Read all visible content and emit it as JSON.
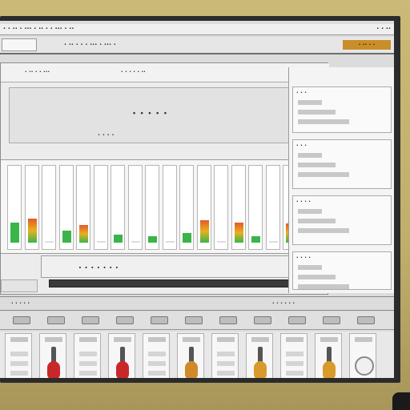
{
  "menubar": {
    "left_text": "· · ·· · ··· · ·· · · ··· · ··",
    "right_text": "· · ··"
  },
  "toolbar": {
    "label": "· ·· · · · ··· · ··· ·",
    "badge": "· ·· · ·"
  },
  "main_panel": {
    "strip_left": "· ·· · · ···",
    "strip_right": "· · · · · ··"
  },
  "banner": {
    "title": "· · · · ·",
    "subtitle": "· · · ·"
  },
  "mixer": {
    "channels": [
      {
        "level": 0.25,
        "color": "#39b54a"
      },
      {
        "level": 0.3,
        "color": "#e45a2a"
      },
      {
        "level": 0.0,
        "color": "#39b54a"
      },
      {
        "level": 0.15,
        "color": "#39b54a"
      },
      {
        "level": 0.22,
        "color": "#e45a2a"
      },
      {
        "level": 0.0,
        "color": "#39b54a"
      },
      {
        "level": 0.1,
        "color": "#39b54a"
      },
      {
        "level": 0.0,
        "color": "#39b54a"
      },
      {
        "level": 0.08,
        "color": "#39b54a"
      },
      {
        "level": 0.0,
        "color": "#39b54a"
      },
      {
        "level": 0.12,
        "color": "#39b54a"
      },
      {
        "level": 0.28,
        "color": "#e45a2a"
      },
      {
        "level": 0.0,
        "color": "#39b54a"
      },
      {
        "level": 0.25,
        "color": "#e45a2a"
      },
      {
        "level": 0.08,
        "color": "#39b54a"
      },
      {
        "level": 0.0,
        "color": "#39b54a"
      },
      {
        "level": 0.24,
        "color": "#e45a2a"
      },
      {
        "level": 0.0,
        "color": "#39b54a"
      }
    ]
  },
  "caption": "· · · · · · ·",
  "sidebar": {
    "blocks": [
      {
        "title": "· · ·"
      },
      {
        "title": "· · ·"
      },
      {
        "title": "· · · ·"
      },
      {
        "title": "· · · ·"
      }
    ]
  },
  "rack": {
    "header_left": "· · · · ·",
    "header_right": "· · · · · ·",
    "slots": [
      {
        "knob_color": ""
      },
      {
        "knob_color": "#c9282a"
      },
      {
        "knob_color": ""
      },
      {
        "knob_color": "#c9282a"
      },
      {
        "knob_color": ""
      },
      {
        "knob_color": "#d08a2a"
      },
      {
        "knob_color": ""
      },
      {
        "knob_color": "#d89a2a"
      },
      {
        "knob_color": ""
      },
      {
        "knob_color": "#d89a2a"
      },
      {
        "knob_color": "ring"
      }
    ]
  }
}
